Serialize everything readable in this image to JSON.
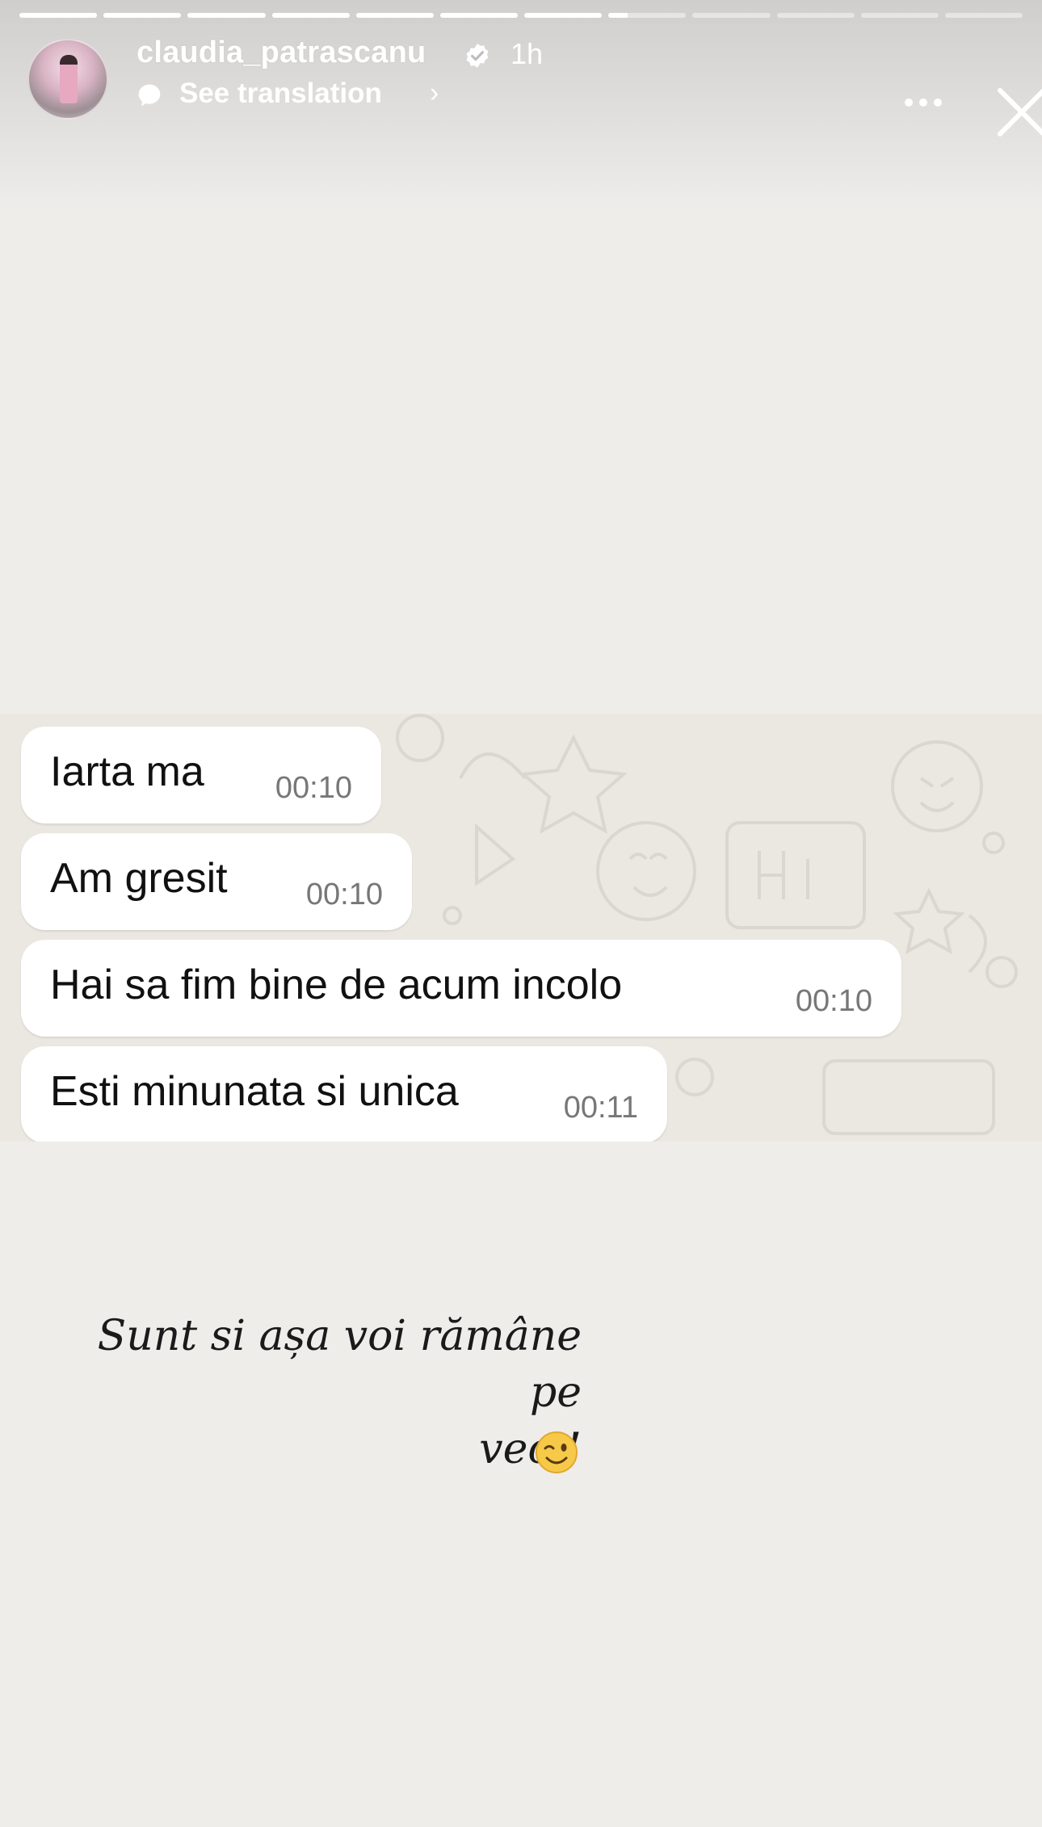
{
  "story": {
    "progress": {
      "segments": 12,
      "completed": 7,
      "current_fraction": 0.25
    },
    "header": {
      "username": "claudia_patrascanu",
      "time_ago": "1h",
      "translate_label": "See translation",
      "chevron": "›",
      "verified_icon": "verified-badge-icon",
      "more_icon": "more-options-icon",
      "close_icon": "close-icon"
    },
    "chat": {
      "background": "#ebe7e1",
      "messages": [
        {
          "text": "Iarta ma",
          "time": "00:10"
        },
        {
          "text": "Am gresit",
          "time": "00:10"
        },
        {
          "text": "Hai sa fim bine de acum incolo",
          "time": "00:10"
        },
        {
          "text": "Esti minunata si unica",
          "time": "00:11"
        }
      ]
    },
    "caption": {
      "line1": "Sunt si așa voi rămâne pe",
      "line2": "veci!",
      "emoji": "winking-face-emoji"
    },
    "colors": {
      "background": "#efedea",
      "bubble": "#ffffff",
      "timestamp": "#777777"
    }
  }
}
